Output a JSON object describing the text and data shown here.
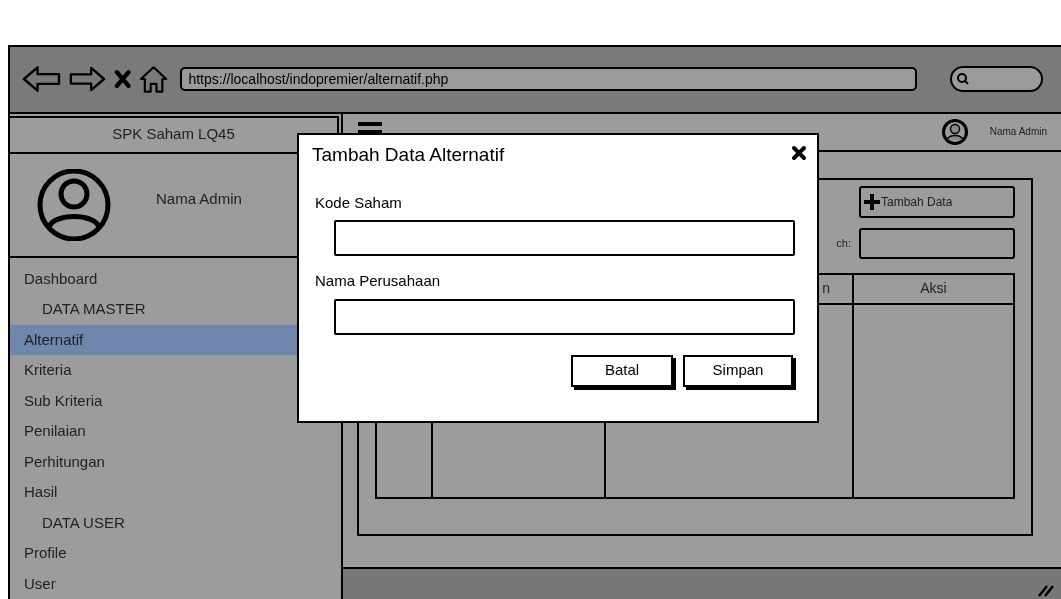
{
  "browser": {
    "url": "https://localhost/indopremier/alternatif.php"
  },
  "sidebar": {
    "title": "SPK Saham LQ45",
    "user_name": "Nama Admin",
    "items": [
      {
        "label": "Dashboard",
        "kind": "item",
        "selected": false
      },
      {
        "label": "DATA MASTER",
        "kind": "heading",
        "selected": false
      },
      {
        "label": "Alternatif",
        "kind": "item",
        "selected": true
      },
      {
        "label": "Kriteria",
        "kind": "item",
        "selected": false
      },
      {
        "label": "Sub Kriteria",
        "kind": "item",
        "selected": false
      },
      {
        "label": "Penilaian",
        "kind": "item",
        "selected": false
      },
      {
        "label": "Perhitungan",
        "kind": "item",
        "selected": false
      },
      {
        "label": "Hasil",
        "kind": "item",
        "selected": false
      },
      {
        "label": "DATA USER",
        "kind": "heading",
        "selected": false
      },
      {
        "label": "Profile",
        "kind": "item",
        "selected": false
      },
      {
        "label": "User",
        "kind": "item",
        "selected": false
      }
    ]
  },
  "header": {
    "user_name": "Nama Admin"
  },
  "content": {
    "add_button": "Tambah Data",
    "search_label": "ch:",
    "table": {
      "column_3": "n",
      "column_4": "Aksi"
    }
  },
  "dialog": {
    "title": "Tambah Data Alternatif",
    "fields": [
      {
        "label": "Kode Saham"
      },
      {
        "label": "Nama Perusahaan"
      }
    ],
    "buttons": [
      "Batal",
      "Simpan"
    ]
  }
}
